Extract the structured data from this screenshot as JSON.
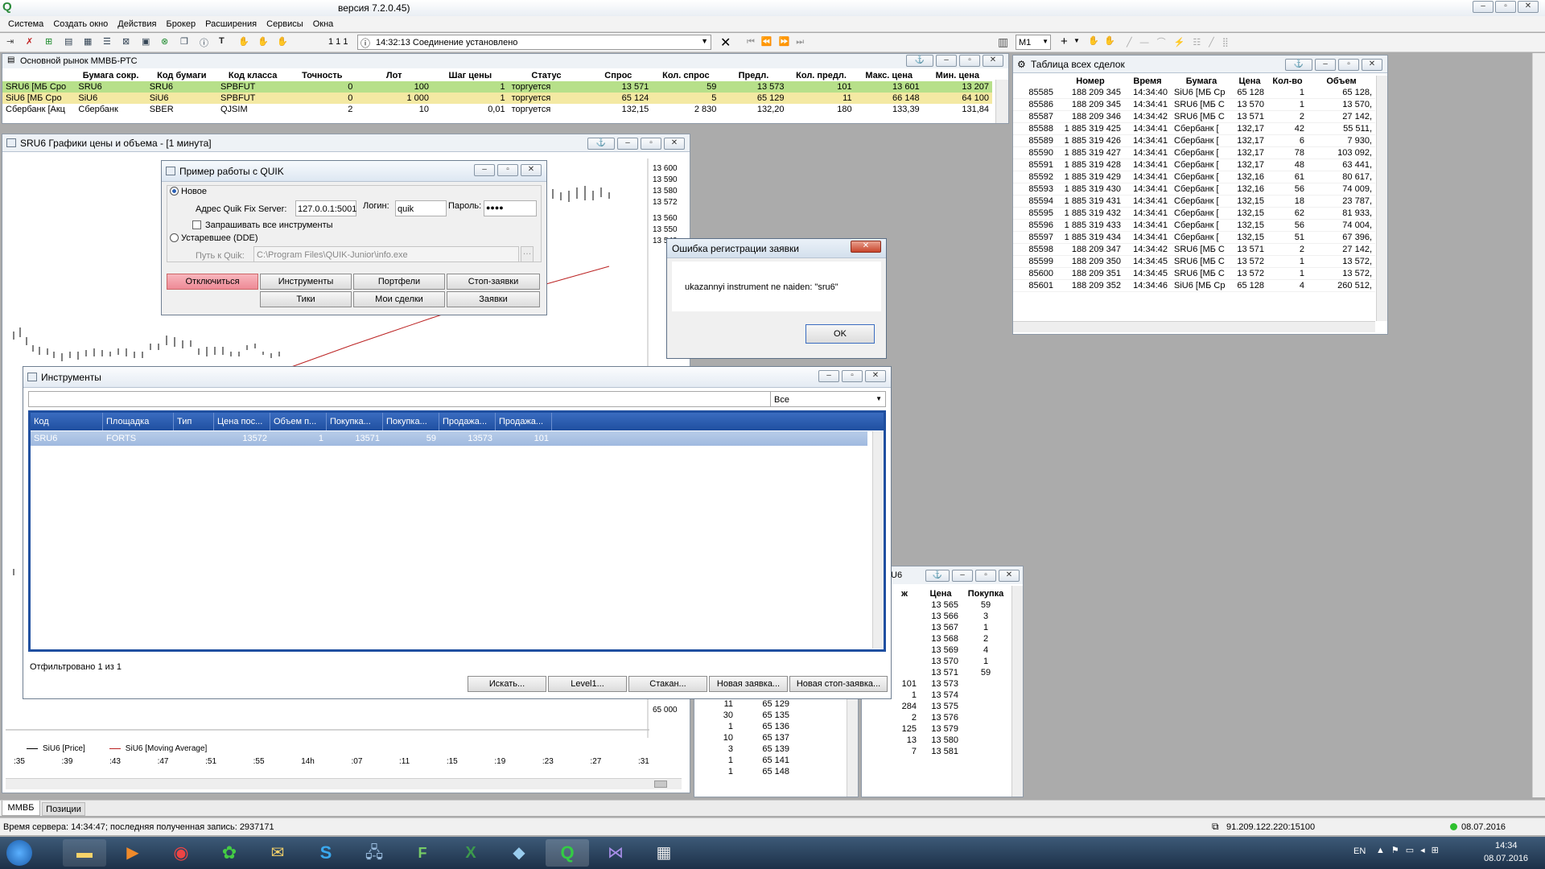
{
  "app": {
    "title": "версия 7.2.0.45)",
    "menu": [
      "Система",
      "Создать окно",
      "Действия",
      "Брокер",
      "Расширения",
      "Сервисы",
      "Окна"
    ],
    "toolbar": {
      "counter": "1 1 1",
      "status_message": "14:32:13 Соединение установлено",
      "timeframe": "M1"
    }
  },
  "market": {
    "title": "Основной рынок ММВБ-РТС",
    "headers": [
      "",
      "Бумага сокр.",
      "Код бумаги",
      "Код класса",
      "Точность",
      "Лот",
      "Шаг цены",
      "Статус",
      "Спрос",
      "Кол. спрос",
      "Предл.",
      "Кол. предл.",
      "Макс. цена",
      "Мин. цена"
    ],
    "rows": [
      {
        "name": "SRU6 [МБ Сро",
        "short": "SRU6",
        "code": "SRU6",
        "class": "SPBFUT",
        "prec": "0",
        "lot": "100",
        "step": "1",
        "status": "торгуется",
        "bid": "13 571",
        "bidqty": "59",
        "ask": "13 573",
        "askqty": "101",
        "max": "13 601",
        "min": "13 207",
        "color": "#b7e08a"
      },
      {
        "name": "SiU6 [МБ Сро",
        "short": "SiU6",
        "code": "SiU6",
        "class": "SPBFUT",
        "prec": "0",
        "lot": "1 000",
        "step": "1",
        "status": "торгуется",
        "bid": "65 124",
        "bidqty": "5",
        "ask": "65 129",
        "askqty": "11",
        "max": "66 148",
        "min": "64 100",
        "color": "#f4e9a3"
      },
      {
        "name": "Сбербанк [Акц",
        "short": "Сбербанк",
        "code": "SBER",
        "class": "QJSIM",
        "prec": "2",
        "lot": "10",
        "step": "0,01",
        "status": "торгуется",
        "bid": "132,15",
        "bidqty": "2 830",
        "ask": "132,20",
        "askqty": "180",
        "max": "133,39",
        "min": "131,84",
        "color": "#ffffff"
      }
    ]
  },
  "chart": {
    "title": "SRU6 Графики цены и объема - [1 минута]",
    "price_labels": [
      "13 600",
      "13 590",
      "13 580",
      "13 572",
      "13 560",
      "13 550",
      "13 540"
    ],
    "lower_label": "65 000",
    "legend": [
      "SiU6 [Price]",
      "SiU6 [Moving Average]"
    ],
    "time_labels": [
      ":35",
      ":39",
      ":43",
      ":47",
      ":51",
      ":55",
      "14h",
      ":07",
      ":11",
      ":15",
      ":19",
      ":23",
      ":27",
      ":31"
    ]
  },
  "quik_demo": {
    "title": "Пример работы с QUIK",
    "radio_new": "Новое",
    "server_label": "Адрес Quik Fix Server:",
    "server_value": "127.0.0.1:5001",
    "login_label": "Логин:",
    "login_value": "quik",
    "password_label": "Пароль:",
    "password_value": "●●●●",
    "checkbox_label": "Запрашивать все инструменты",
    "radio_old": "Устаревшее (DDE)",
    "path_label": "Путь к Quik:",
    "path_value": "C:\\Program Files\\QUIK-Junior\\info.exe",
    "buttons": {
      "disconnect": "Отключиться",
      "instruments": "Инструменты",
      "portfolio": "Портфели",
      "stop_orders": "Стоп-заявки",
      "ticks": "Тики",
      "my_trades": "Мои сделки",
      "orders": "Заявки"
    }
  },
  "error_dialog": {
    "title": "Ошибка регистрации заявки",
    "message": "ukazannyi instrument ne naiden: \"sru6\"",
    "ok": "OK"
  },
  "instruments": {
    "title": "Инструменты",
    "filter_value": "Все",
    "headers": [
      "Код",
      "Площадка",
      "Тип",
      "Цена пос...",
      "Объем п...",
      "Покупка...",
      "Покупка...",
      "Продажа...",
      "Продажа..."
    ],
    "row": [
      "SRU6",
      "FORTS",
      "",
      "13572",
      "1",
      "13571",
      "59",
      "13573",
      "101"
    ],
    "status": "Отфильтровано 1 из 1",
    "buttons": {
      "search": "Искать...",
      "level1": "Level1...",
      "orderbook": "Стакан...",
      "new_order": "Новая заявка...",
      "new_stop": "Новая стоп-заявка..."
    }
  },
  "trades": {
    "title": "Таблица всех сделок",
    "headers": [
      "",
      "Номер",
      "Время",
      "Бумага",
      "Цена",
      "Кол-во",
      "Объем"
    ],
    "rows": [
      [
        "85585",
        "188 209 345",
        "14:34:40",
        "SiU6 [МБ Ср",
        "65 128",
        "1",
        "65 128,"
      ],
      [
        "85586",
        "188 209 345",
        "14:34:41",
        "SRU6 [МБ С",
        "13 570",
        "1",
        "13 570,"
      ],
      [
        "85587",
        "188 209 346",
        "14:34:42",
        "SRU6 [МБ С",
        "13 571",
        "2",
        "27 142,"
      ],
      [
        "85588",
        "1 885 319 425",
        "14:34:41",
        "Сбербанк [",
        "132,17",
        "42",
        "55 511,"
      ],
      [
        "85589",
        "1 885 319 426",
        "14:34:41",
        "Сбербанк [",
        "132,17",
        "6",
        "7 930,"
      ],
      [
        "85590",
        "1 885 319 427",
        "14:34:41",
        "Сбербанк [",
        "132,17",
        "78",
        "103 092,"
      ],
      [
        "85591",
        "1 885 319 428",
        "14:34:41",
        "Сбербанк [",
        "132,17",
        "48",
        "63 441,"
      ],
      [
        "85592",
        "1 885 319 429",
        "14:34:41",
        "Сбербанк [",
        "132,16",
        "61",
        "80 617,"
      ],
      [
        "85593",
        "1 885 319 430",
        "14:34:41",
        "Сбербанк [",
        "132,16",
        "56",
        "74 009,"
      ],
      [
        "85594",
        "1 885 319 431",
        "14:34:41",
        "Сбербанк [",
        "132,15",
        "18",
        "23 787,"
      ],
      [
        "85595",
        "1 885 319 432",
        "14:34:41",
        "Сбербанк [",
        "132,15",
        "62",
        "81 933,"
      ],
      [
        "85596",
        "1 885 319 433",
        "14:34:41",
        "Сбербанк [",
        "132,15",
        "56",
        "74 004,"
      ],
      [
        "85597",
        "1 885 319 434",
        "14:34:41",
        "Сбербанк [",
        "132,15",
        "51",
        "67 396,"
      ],
      [
        "85598",
        "188 209 347",
        "14:34:42",
        "SRU6 [МБ С",
        "13 571",
        "2",
        "27 142,"
      ],
      [
        "85599",
        "188 209 350",
        "14:34:45",
        "SRU6 [МБ С",
        "13 572",
        "1",
        "13 572,"
      ],
      [
        "85600",
        "188 209 351",
        "14:34:45",
        "SRU6 [МБ С",
        "13 572",
        "1",
        "13 572,"
      ],
      [
        "85601",
        "188 209 352",
        "14:34:46",
        "SiU6 [МБ Ср",
        "65 128",
        "4",
        "260 512,"
      ]
    ]
  },
  "orderbook_sru": {
    "title_fragment": "U6",
    "headers": [
      "ж",
      "Цена",
      "Покупка"
    ],
    "bids": [
      [
        "",
        "13 565",
        "59"
      ],
      [
        "",
        "13 566",
        "3"
      ],
      [
        "",
        "13 567",
        "1"
      ],
      [
        "",
        "13 568",
        "2"
      ],
      [
        "",
        "13 569",
        "4"
      ],
      [
        "",
        "13 570",
        "1"
      ],
      [
        "",
        "13 571",
        "59"
      ]
    ],
    "asks": [
      [
        "101",
        "13 573",
        ""
      ],
      [
        "1",
        "13 574",
        ""
      ],
      [
        "284",
        "13 575",
        ""
      ],
      [
        "2",
        "13 576",
        ""
      ],
      [
        "125",
        "13 579",
        ""
      ],
      [
        "13",
        "13 580",
        ""
      ],
      [
        "7",
        "13 581",
        ""
      ]
    ]
  },
  "orderbook_si": {
    "rows": [
      [
        "11",
        "65 129"
      ],
      [
        "30",
        "65 135"
      ],
      [
        "1",
        "65 136"
      ],
      [
        "10",
        "65 137"
      ],
      [
        "3",
        "65 139"
      ],
      [
        "1",
        "65 141"
      ],
      [
        "1",
        "65 148"
      ]
    ]
  },
  "tabs": [
    "ММВБ",
    "Позиции"
  ],
  "statusbar": {
    "server_time": "Время сервера: 14:34:47; последняя полученная запись: 2937171",
    "connection": "91.209.122.220:15100",
    "date": "08.07.2016"
  },
  "taskbar": {
    "lang": "EN",
    "time": "14:34",
    "date": "08.07.2016"
  },
  "colors": {
    "accent_blue": "#1f4fa0",
    "row_green": "#b7e08a",
    "row_yellow": "#f4e9a3",
    "disconnect_red": "#f4a0a8"
  }
}
